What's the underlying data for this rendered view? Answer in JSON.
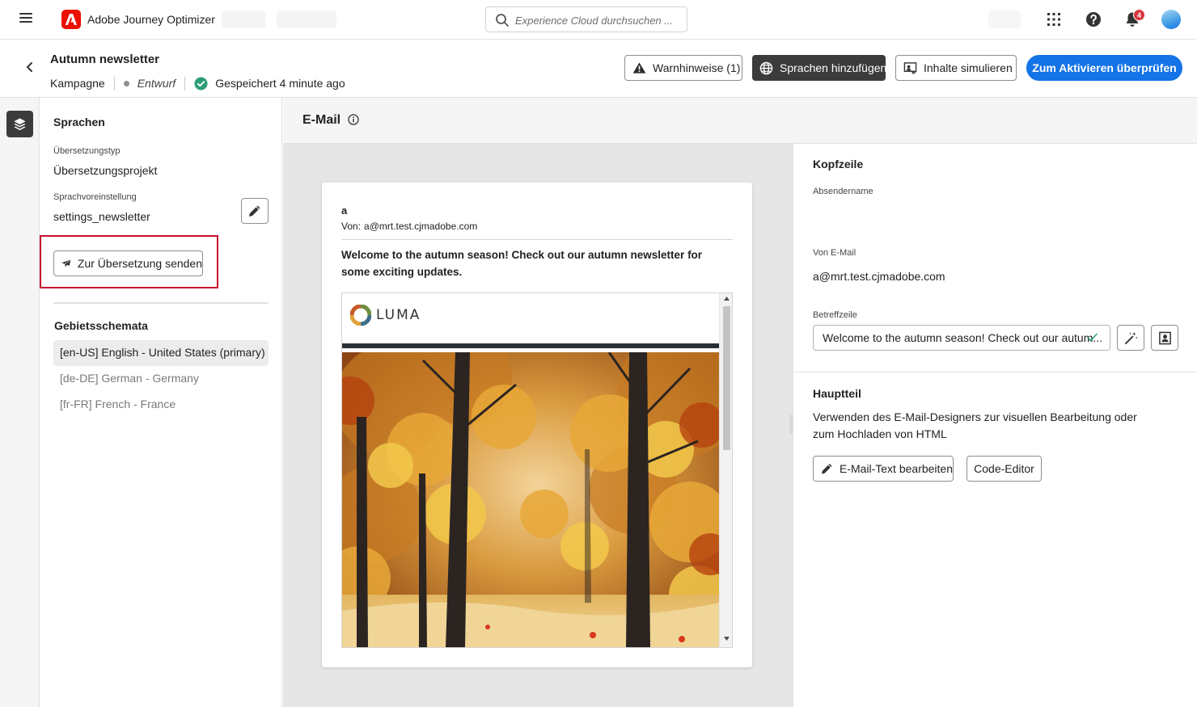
{
  "app": {
    "name": "Adobe Journey Optimizer"
  },
  "search": {
    "placeholder": "Experience Cloud durchsuchen ..."
  },
  "notifications": {
    "count": "4"
  },
  "campaign": {
    "title": "Autumn newsletter",
    "type": "Kampagne",
    "status": "Entwurf",
    "saved_label": "Gespeichert",
    "saved_time": "4 minute ago"
  },
  "actions": {
    "warnings": "Warnhinweise (1)",
    "add_languages": "Sprachen hinzufügen",
    "simulate": "Inhalte simulieren",
    "review": "Zum Aktivieren überprüfen"
  },
  "languages_panel": {
    "title": "Sprachen",
    "translation_type_label": "Übersetzungstyp",
    "translation_type_value": "Übersetzungsprojekt",
    "language_setting_label": "Sprachvoreinstellung",
    "language_setting_value": "settings_newsletter",
    "send_button": "Zur Übersetzung senden",
    "locales_title": "Gebietsschemata",
    "locales": [
      {
        "label": "[en-US] English - United States (primary)",
        "active": true
      },
      {
        "label": "[de-DE] German - Germany",
        "active": false
      },
      {
        "label": "[fr-FR] French - France",
        "active": false
      }
    ]
  },
  "email": {
    "section_title": "E-Mail",
    "preview": {
      "sender": "a",
      "from_prefix": "Von:",
      "from_address": "a@mrt.test.cjmadobe.com",
      "subject": "Welcome to the autumn season! Check out our autumn newsletter for some exciting updates.",
      "logo_text": "LUMA"
    }
  },
  "header_panel": {
    "title": "Kopfzeile",
    "sender_name_label": "Absendername",
    "sender_name_value": "",
    "from_email_label": "Von E-Mail",
    "from_email_value": "a@mrt.test.cjmadobe.com",
    "subject_label": "Betreffzeile",
    "subject_value": "Welcome to the autumn season! Check out our autum..."
  },
  "body_panel": {
    "title": "Hauptteil",
    "description": "Verwenden des E-Mail-Designers zur visuellen Bearbeitung oder zum Hochladen von HTML",
    "edit_button": "E-Mail-Text bearbeiten",
    "code_button": "Code-Editor"
  },
  "icons": {
    "menu": "hamburger-menu-icon",
    "brand": "adobe-logo-icon",
    "search": "search-icon",
    "apps": "app-grid-icon",
    "help": "help-icon",
    "bell": "bell-icon",
    "back": "chevron-left-icon",
    "draft_dot": "status-dot-icon",
    "saved": "check-circle-icon",
    "warning": "alert-triangle-icon",
    "globe": "globe-icon",
    "simulate": "preview-icon",
    "layers": "layers-icon",
    "pencil": "pencil-icon",
    "send": "paper-plane-icon",
    "info": "info-icon",
    "magic": "magic-wand-icon",
    "personalize": "personalization-icon"
  },
  "colors": {
    "accent": "#1473e6",
    "brand": "#eb1000",
    "highlight": "#c8102e",
    "success": "#2d9d78",
    "dark_button": "#3b3b3b"
  }
}
